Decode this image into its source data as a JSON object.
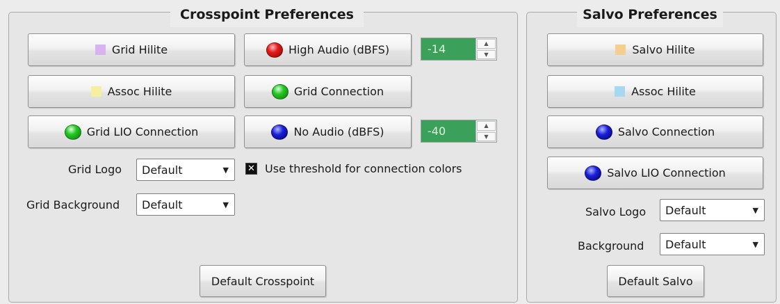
{
  "crosspoint": {
    "title": "Crosspoint Preferences",
    "grid_hilite": "Grid Hilite",
    "assoc_hilite": "Assoc Hilite",
    "grid_lio_connection": "Grid LIO Connection",
    "high_audio": "High Audio (dBFS)",
    "high_audio_value": "-14",
    "grid_connection": "Grid Connection",
    "no_audio": "No Audio (dBFS)",
    "no_audio_value": "-40",
    "grid_logo_label": "Grid Logo",
    "grid_logo_value": "Default",
    "grid_background_label": "Grid Background",
    "grid_background_value": "Default",
    "threshold_label": "Use threshold for connection colors",
    "default_button": "Default Crosspoint"
  },
  "salvo": {
    "title": "Salvo Preferences",
    "salvo_hilite": "Salvo Hilite",
    "assoc_hilite": "Assoc Hilite",
    "salvo_connection": "Salvo Connection",
    "salvo_lio_connection": "Salvo LIO Connection",
    "salvo_logo_label": "Salvo Logo",
    "salvo_logo_value": "Default",
    "background_label": "Background",
    "background_value": "Default",
    "default_button": "Default Salvo"
  },
  "colors": {
    "grid_hilite_swatch": "#d9b3f0",
    "assoc_hilite_swatch": "#f5f0a0",
    "salvo_hilite_swatch": "#f3d08f",
    "salvo_assoc_swatch": "#a6d8f2",
    "spin_bg": "#3aa05a",
    "high_audio_led": "red",
    "grid_connection_led": "green",
    "grid_lio_led": "green",
    "no_audio_led": "blue",
    "salvo_connection_led": "blue",
    "salvo_lio_led": "blue"
  }
}
